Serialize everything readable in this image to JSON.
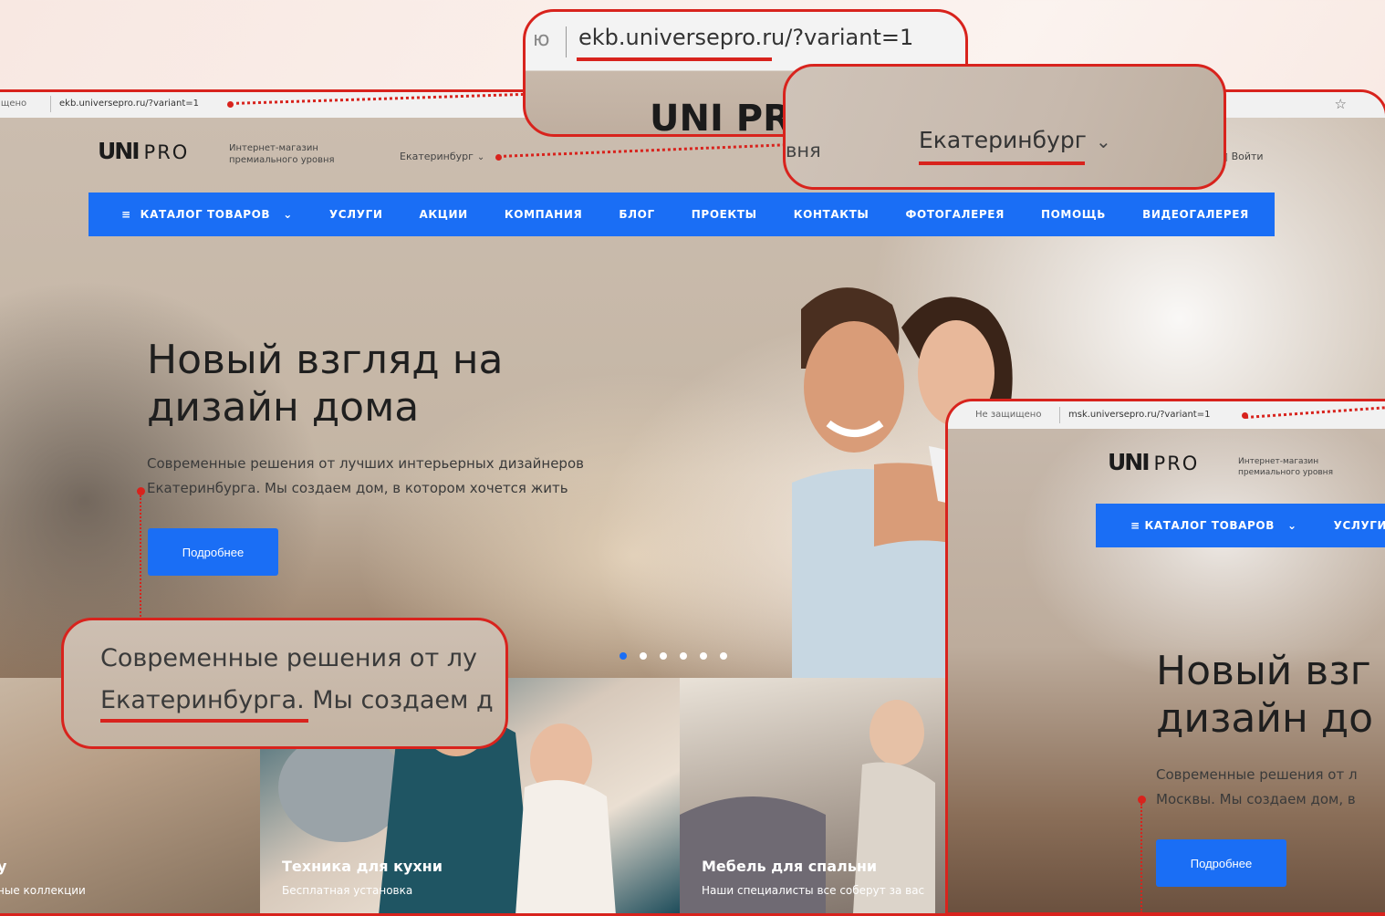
{
  "main_window": {
    "address_bar": {
      "secure_label": "щищено",
      "url": "ekb.universepro.ru/?variant=1"
    },
    "header": {
      "logo_mark": "UNI",
      "logo_text": "PRO",
      "tagline": "Интернет-магазин премиального уровня",
      "city": "Екатеринбург",
      "login": "Войти"
    },
    "nav": {
      "items": [
        "КАТАЛОГ ТОВАРОВ",
        "УСЛУГИ",
        "АКЦИИ",
        "КОМПАНИЯ",
        "БЛОГ",
        "ПРОЕКТЫ",
        "КОНТАКТЫ",
        "ФОТОГАЛЕРЕЯ",
        "ПОМОЩЬ",
        "ВИДЕОГАЛЕРЕЯ"
      ]
    },
    "hero": {
      "title_line1": "Новый взгляд на",
      "title_line2": "дизайн дома",
      "subtitle_line1": "Современные решения от лучших интерьерных дизайнеров",
      "subtitle_line2": "Екатеринбурга. Мы создаем дом, в котором хочется жить",
      "button": "Подробнее",
      "slides_total": 6,
      "active_slide": 1
    },
    "tiles": [
      {
        "title": "у",
        "subtitle": "ные коллекции"
      },
      {
        "title": "Техника для кухни",
        "subtitle": "Бесплатная установка"
      },
      {
        "title": "Мебель для спальни",
        "subtitle": "Наши специалисты все соберут за вас"
      }
    ]
  },
  "callouts": {
    "url": {
      "secure_fragment": "ю",
      "url": "ekb.universepro.ru/?variant=1",
      "logo_fragment": "UNI PR"
    },
    "city": {
      "fragment": "вня",
      "city": "Екатеринбург"
    },
    "text": {
      "line1": "Современные решения от лу",
      "line2": "Екатеринбурга. Мы создаем д"
    }
  },
  "second_window": {
    "address_bar": {
      "secure_label": "Не защищено",
      "url": "msk.universepro.ru/?variant=1"
    },
    "header": {
      "logo_mark": "UNI",
      "logo_text": "PRO",
      "tagline": "Интернет-магазин премиального уровня"
    },
    "nav": {
      "items": [
        "КАТАЛОГ ТОВАРОВ",
        "УСЛУГИ"
      ]
    },
    "hero": {
      "title_line1": "Новый взг",
      "title_line2": "дизайн до",
      "subtitle_line1": "Современные решения от л",
      "subtitle_line2": "Москвы. Мы создаем дом, в",
      "button": "Подробнее"
    }
  },
  "colors": {
    "accent": "#1a6ef5",
    "highlight": "#d8231d"
  }
}
